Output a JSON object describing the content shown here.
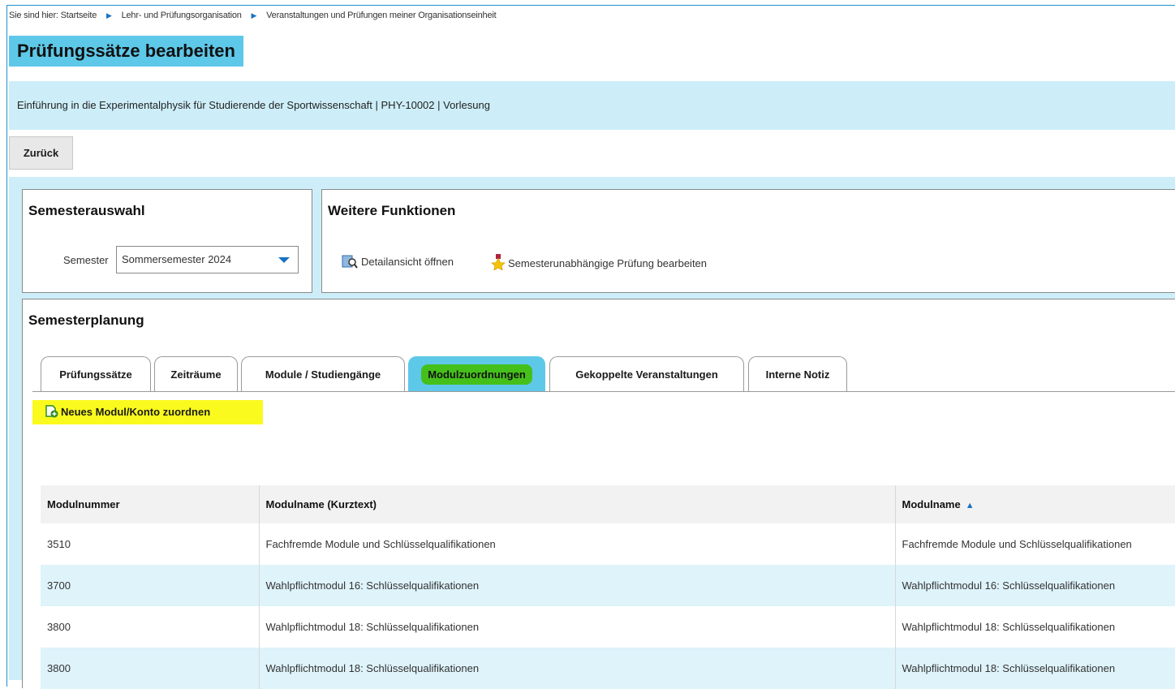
{
  "breadcrumb": {
    "prefix": "Sie sind hier:",
    "items": [
      "Startseite",
      "Lehr- und Prüfungsorganisation",
      "Veranstaltungen und Prüfungen meiner Organisationseinheit"
    ]
  },
  "page_title": "Prüfungssätze bearbeiten",
  "course_info": "Einführung in die Experimentalphysik für Studierende der Sportwissenschaft | PHY-10002 | Vorlesung",
  "back_button": "Zurück",
  "semester_panel": {
    "title": "Semesterauswahl",
    "label": "Semester",
    "selected": "Sommersemester 2024"
  },
  "functions_panel": {
    "title": "Weitere Funktionen",
    "detail_link": "Detailansicht öffnen",
    "exam_link": "Semesterunabhängige Prüfung bearbeiten"
  },
  "planning": {
    "title": "Semesterplanung",
    "tabs": [
      "Prüfungssätze",
      "Zeiträume",
      "Module / Studiengänge",
      "Modulzuordnungen",
      "Gekoppelte Veranstaltungen",
      "Interne Notiz"
    ],
    "active_tab": "Modulzuordnungen",
    "assign_link": "Neues Modul/Konto zuordnen"
  },
  "table": {
    "headers": [
      "Modulnummer",
      "Modulname (Kurztext)",
      "Modulname"
    ],
    "rows": [
      [
        "3510",
        "Fachfremde Module und Schlüsselqualifikationen",
        "Fachfremde Module und Schlüsselqualifikationen"
      ],
      [
        "3700",
        "Wahlpflichtmodul 16: Schlüsselqualifikationen",
        "Wahlpflichtmodul 16: Schlüsselqualifikationen"
      ],
      [
        "3800",
        "Wahlpflichtmodul 18: Schlüsselqualifikationen",
        "Wahlpflichtmodul 18: Schlüsselqualifikationen"
      ],
      [
        "3800",
        "Wahlpflichtmodul 18: Schlüsselqualifikationen",
        "Wahlpflichtmodul 18: Schlüsselqualifikationen"
      ]
    ]
  },
  "colors": {
    "accent": "#5ec8e8",
    "band": "#cdeef8",
    "highlight_yellow": "#fafa1e",
    "highlight_green": "#45c01b"
  }
}
